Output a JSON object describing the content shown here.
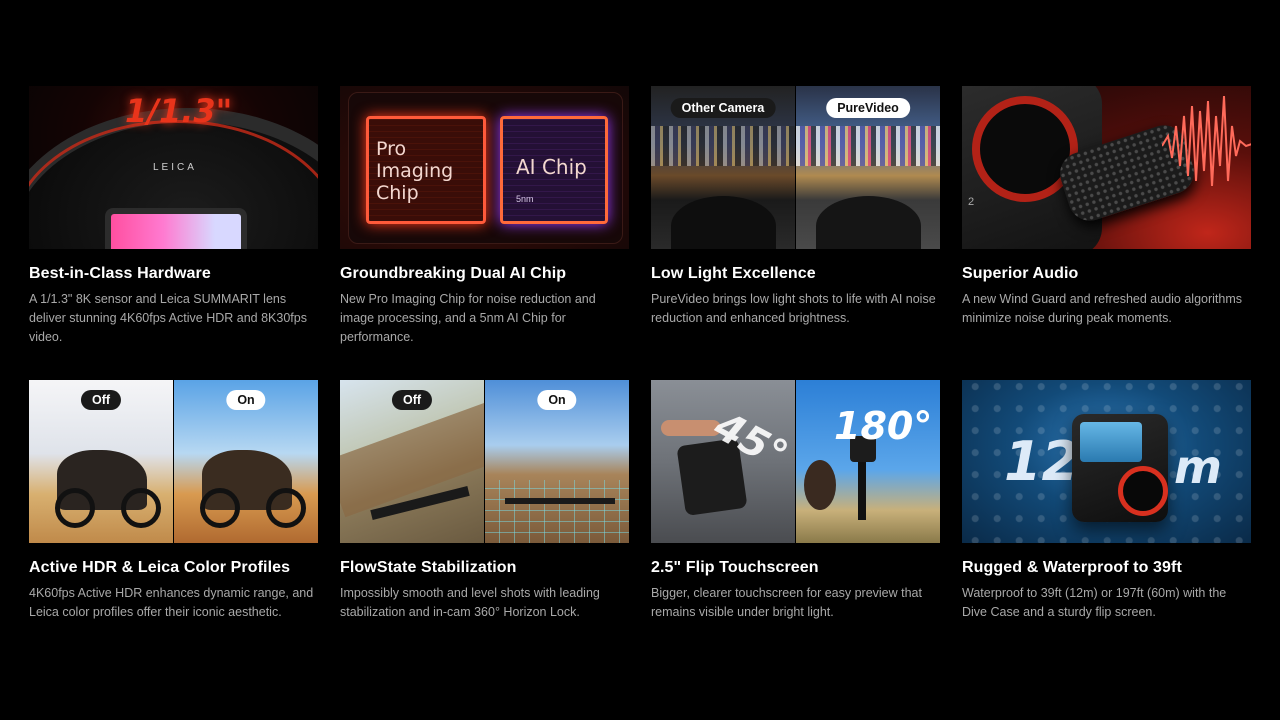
{
  "cards": [
    {
      "title": "Best-in-Class Hardware",
      "desc": "A 1/1.3\" 8K sensor and Leica SUMMARIT lens deliver stunning 4K60fps Active HDR and 8K30fps video.",
      "overlay_big": "1/1.3\"",
      "overlay_brand": "LEICA"
    },
    {
      "title": "Groundbreaking Dual AI Chip",
      "desc": "New Pro Imaging Chip for noise reduction and image processing, and a 5nm AI Chip for performance.",
      "chip1": "Pro Imaging Chip",
      "chip2": "AI Chip",
      "chip2_sub": "5nm"
    },
    {
      "title": "Low Light Excellence",
      "desc": "PureVideo brings low light shots to life with AI noise reduction and enhanced brightness.",
      "left_label": "Other Camera",
      "right_label": "PureVideo"
    },
    {
      "title": "Superior Audio",
      "desc": "A new Wind Guard and refreshed audio algorithms minimize noise during peak moments.",
      "side_num": "2"
    },
    {
      "title": "Active HDR & Leica Color Profiles",
      "desc": "4K60fps Active HDR enhances dynamic range, and Leica color profiles offer their iconic aesthetic.",
      "left_label": "Off",
      "right_label": "On"
    },
    {
      "title": "FlowState Stabilization",
      "desc": "Impossibly smooth and level shots with leading stabilization and in-cam 360° Horizon Lock.",
      "left_label": "Off",
      "right_label": "On"
    },
    {
      "title": "2.5\" Flip Touchscreen",
      "desc": "Bigger, clearer touchscreen for easy preview that remains visible under bright light.",
      "left_angle": "45°",
      "right_angle": "180°"
    },
    {
      "title": "Rugged & Waterproof to 39ft",
      "desc": "Waterproof to 39ft (12m) or 197ft (60m) with the Dive Case and a sturdy flip screen.",
      "depth_left": "12",
      "depth_right": "m"
    }
  ]
}
